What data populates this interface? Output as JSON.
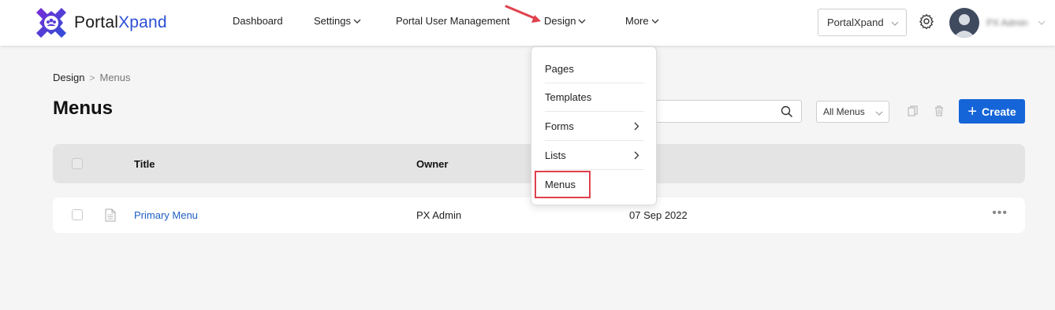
{
  "app": {
    "logo_text_dark": "Portal",
    "logo_text_brand": "Xpand",
    "brand_color": "#2d4fd6"
  },
  "nav": {
    "dashboard": "Dashboard",
    "settings": "Settings",
    "portal_user_management": "Portal User Management",
    "design": "Design",
    "more": "More"
  },
  "header_right": {
    "portal_select_value": "PortalXpand",
    "user_name": "PX Admin",
    "gear_icon": "gear-icon"
  },
  "design_menu": {
    "items": [
      {
        "label": "Pages",
        "has_submenu": false
      },
      {
        "label": "Templates",
        "has_submenu": false
      },
      {
        "label": "Forms",
        "has_submenu": true
      },
      {
        "label": "Lists",
        "has_submenu": true
      },
      {
        "label": "Menus",
        "has_submenu": false,
        "highlighted": true
      }
    ]
  },
  "breadcrumb": {
    "parent": "Design",
    "separator": ">",
    "current": "Menus"
  },
  "page": {
    "title": "Menus"
  },
  "toolbar": {
    "search_placeholder": "",
    "filter_value": "All Menus",
    "create_label": "Create",
    "create_icon": "+",
    "accent_color": "#1565d8"
  },
  "table": {
    "columns": [
      "Title",
      "Owner",
      ""
    ],
    "rows": [
      {
        "title": "Primary Menu",
        "owner": "PX Admin",
        "date": "07 Sep 2022",
        "actions": "•••"
      }
    ]
  },
  "annotations": {
    "highlight_color": "#e0414c"
  }
}
